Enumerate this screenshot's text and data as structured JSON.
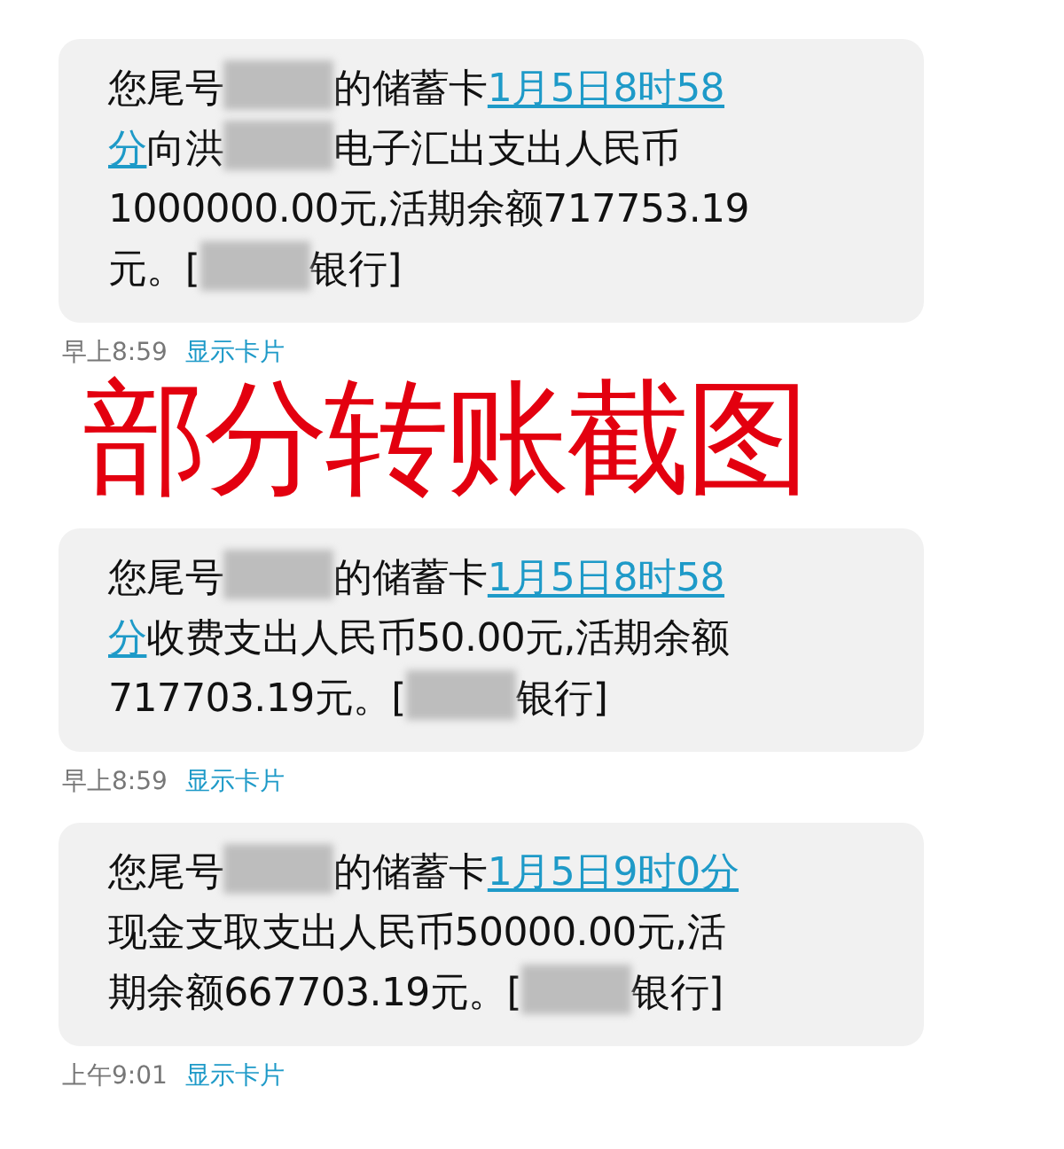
{
  "messages": [
    {
      "lines": [
        [
          {
            "kind": "text",
            "text": "您尾号"
          },
          {
            "kind": "redacted"
          },
          {
            "kind": "text",
            "text": "的储蓄卡"
          },
          {
            "kind": "link",
            "text": "1月5日8时58"
          }
        ],
        [
          {
            "kind": "link",
            "text": "分"
          },
          {
            "kind": "text",
            "text": "向洪"
          },
          {
            "kind": "redacted"
          },
          {
            "kind": "text",
            "text": "电子汇出支出人民币"
          }
        ],
        [
          {
            "kind": "text",
            "text": "1000000.00元,活期余额717753.19"
          }
        ],
        [
          {
            "kind": "text",
            "text": "元。["
          },
          {
            "kind": "redacted"
          },
          {
            "kind": "text",
            "text": "银行]"
          }
        ]
      ],
      "time": "早上8:59",
      "card_link": "显示卡片"
    },
    {
      "lines": [
        [
          {
            "kind": "text",
            "text": "您尾号"
          },
          {
            "kind": "redacted"
          },
          {
            "kind": "text",
            "text": "的储蓄卡"
          },
          {
            "kind": "link",
            "text": "1月5日8时58"
          }
        ],
        [
          {
            "kind": "link",
            "text": "分"
          },
          {
            "kind": "text",
            "text": "收费支出人民币50.00元,活期余额"
          }
        ],
        [
          {
            "kind": "text",
            "text": "717703.19元。["
          },
          {
            "kind": "redacted"
          },
          {
            "kind": "text",
            "text": "银行]"
          }
        ]
      ],
      "time": "早上8:59",
      "card_link": "显示卡片"
    },
    {
      "lines": [
        [
          {
            "kind": "text",
            "text": "您尾号"
          },
          {
            "kind": "redacted"
          },
          {
            "kind": "text",
            "text": "的储蓄卡"
          },
          {
            "kind": "link",
            "text": "1月5日9时0分"
          }
        ],
        [
          {
            "kind": "text",
            "text": "现金支取支出人民币50000.00元,活"
          }
        ],
        [
          {
            "kind": "text",
            "text": "期余额667703.19元。["
          },
          {
            "kind": "redacted"
          },
          {
            "kind": "text",
            "text": "银行]"
          }
        ]
      ],
      "time": "上午9:01",
      "card_link": "显示卡片"
    }
  ],
  "overlay_caption": "部分转账截图"
}
